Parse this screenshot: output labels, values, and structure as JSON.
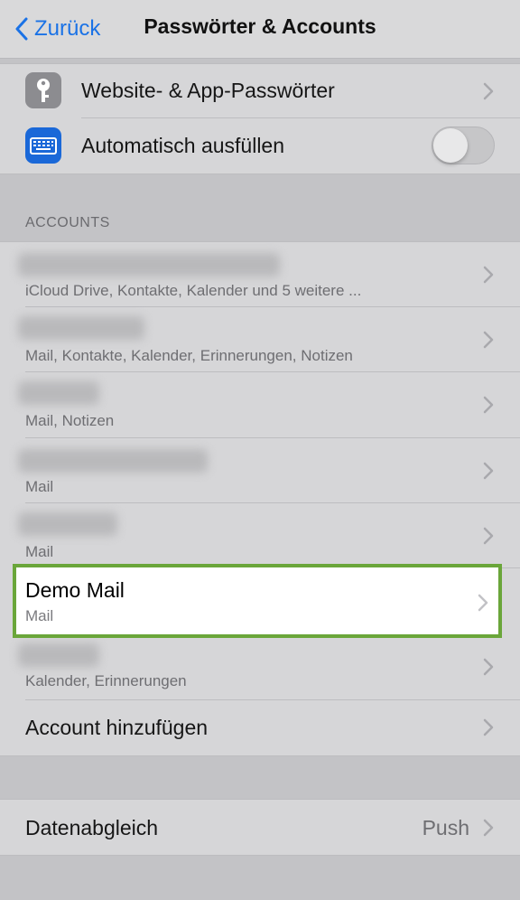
{
  "nav": {
    "back_label": "Zurück",
    "title": "Passwörter & Accounts"
  },
  "top_group": {
    "passwords_label": "Website- & App-Passwörter",
    "autofill_label": "Automatisch ausfüllen",
    "autofill_on": false
  },
  "accounts": {
    "header": "ACCOUNTS",
    "items": [
      {
        "subtitle": "iCloud Drive, Kontakte, Kalender und 5 weitere ..."
      },
      {
        "subtitle": "Mail, Kontakte, Kalender, Erinnerungen, Notizen"
      },
      {
        "subtitle": "Mail, Notizen"
      },
      {
        "subtitle": "Mail"
      },
      {
        "subtitle": "Mail"
      },
      {
        "title": "Demo Mail",
        "subtitle": "Mail"
      },
      {
        "subtitle": "Kalender, Erinnerungen"
      }
    ],
    "add_label": "Account hinzufügen"
  },
  "sync": {
    "label": "Datenabgleich",
    "value": "Push"
  },
  "colors": {
    "accent": "#1a72e6",
    "highlight_border": "#6aa63a"
  }
}
